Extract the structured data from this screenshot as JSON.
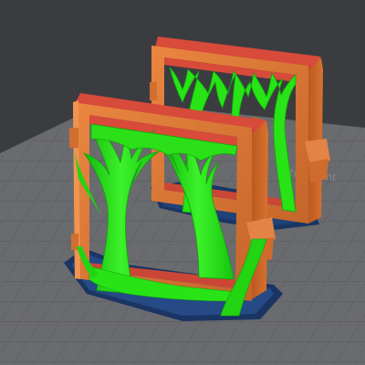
{
  "viewport": {
    "plate_label": "ntum print",
    "colors": {
      "background": "#3a3b3f",
      "build_plate": "#6b6c70",
      "grid_line": "#58595d",
      "part_orange": "#e07a34",
      "part_top_red": "#d9483a",
      "tree_support_green": "#22e014",
      "support_interface_blue": "#1a3a66"
    }
  }
}
